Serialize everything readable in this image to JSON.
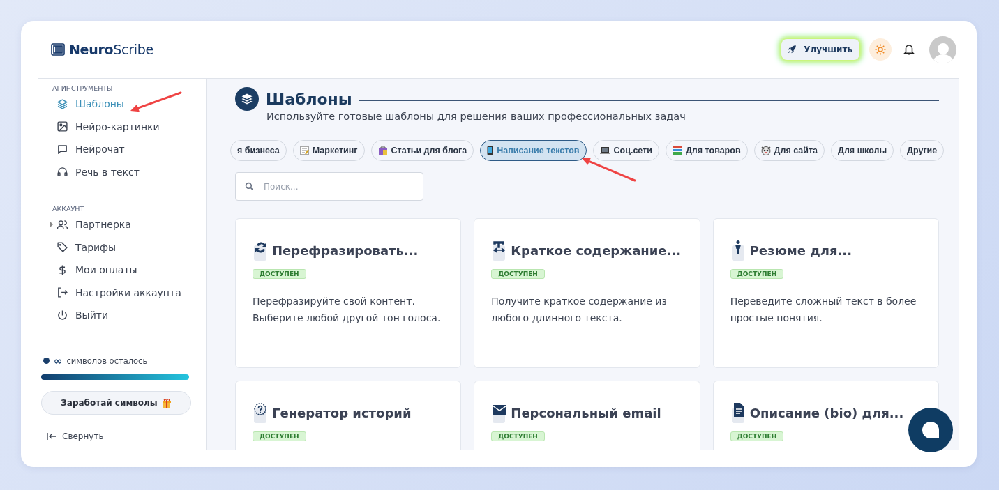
{
  "header": {
    "logo": "**Neuro**Scribe",
    "upgrade_button": "Улучшить"
  },
  "sidebar": {
    "sections": [
      {
        "title": "AI-ИНСТРУМЕНТЫ",
        "items": [
          {
            "label": "Шаблоны",
            "kind": "link",
            "selected": true
          },
          {
            "label": "Нейро-картинки",
            "kind": "link",
            "selected": false
          },
          {
            "label": "Нейрочат",
            "kind": "link",
            "selected": false
          },
          {
            "label": "Речь в текст",
            "kind": "link",
            "selected": false
          }
        ]
      },
      {
        "title": "АККАУНТ",
        "items": [
          {
            "label": "Партнерка",
            "kind": "group",
            "selected": false
          },
          {
            "label": "Тарифы",
            "kind": "link",
            "selected": false
          },
          {
            "label": "Мои оплаты",
            "kind": "link",
            "selected": false
          },
          {
            "label": "Настройки аккаунта",
            "kind": "link",
            "selected": false
          },
          {
            "label": "Выйти",
            "kind": "link",
            "selected": false
          }
        ]
      }
    ],
    "credits": {
      "amount": "∞",
      "label": "символов осталось",
      "level": 1
    },
    "earn_button": "Заработай символы",
    "collapse": "Свернуть"
  },
  "page": {
    "title": "Шаблоны",
    "subtitle": "Используйте готовые шаблоны для решения ваших профессиональных задач",
    "categories": [
      {
        "label": "я бизнеса",
        "selected": false
      },
      {
        "label": "Маркетинг",
        "selected": false
      },
      {
        "label": "Статьи для блога",
        "selected": false
      },
      {
        "label": "Написание текстов",
        "selected": true
      },
      {
        "label": "Соц.сети",
        "selected": false
      },
      {
        "label": "Для товаров",
        "selected": false
      },
      {
        "label": "Для сайта",
        "selected": false
      },
      {
        "label": "Для школы",
        "selected": false
      },
      {
        "label": "Другие",
        "selected": false
      }
    ],
    "search": {
      "placeholder": "Поиск..."
    },
    "templates": [
      {
        "title": "Перефразировать...",
        "status": "ДОСТУПЕН",
        "description": "Перефразируйте свой контент. Выберите любой другой тон голоса."
      },
      {
        "title": "Краткое содержание...",
        "status": "ДОСТУПЕН",
        "description": "Получите краткое содержание из любого длинного текста."
      },
      {
        "title": "Резюме для...",
        "status": "ДОСТУПЕН",
        "description": "Переведите сложный текст в более простые понятия."
      },
      {
        "title": "Генератор историй",
        "status": "ДОСТУПЕН"
      },
      {
        "title": "Персональный email",
        "status": "ДОСТУПЕН"
      },
      {
        "title": "Описание (bio) для...",
        "status": "ДОСТУПЕН"
      }
    ]
  }
}
